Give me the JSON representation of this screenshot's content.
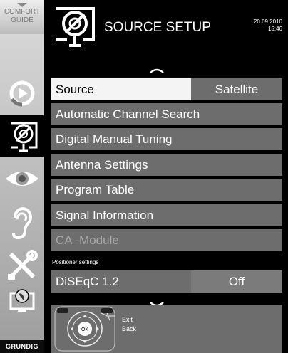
{
  "sidebar": {
    "comfort_guide": [
      "COMFORT",
      "GUIDE"
    ],
    "icons": [
      "source-icon",
      "satellite-dish-icon",
      "eye-icon",
      "ear-icon",
      "tools-icon",
      "globe-monitor-icon"
    ],
    "active_index": 1,
    "brand": "GRUNDIG"
  },
  "header": {
    "title": "SOURCE SETUP",
    "date": "20.09.2010",
    "time": "15:46",
    "icon": "satellite-dish-icon"
  },
  "menu": {
    "items": [
      {
        "label": "Source",
        "value": "Satellite",
        "selected": true
      },
      {
        "label": "Automatic Channel Search"
      },
      {
        "label": "Digital Manual Tuning"
      },
      {
        "label": "Antenna Settings"
      },
      {
        "label": "Program Table"
      },
      {
        "label": "Signal Information"
      },
      {
        "label": "CA -Module",
        "disabled": true
      }
    ],
    "section_label": "Positioner settings",
    "positioner": {
      "label": "DiSEqC 1.2",
      "value": "Off"
    }
  },
  "remote": {
    "ok_label": "OK",
    "exit_label": "Exit",
    "back_label": "Back"
  },
  "colors": {
    "background": "#000000",
    "row": "#6d6d6d",
    "row_selected": "#f4f4f4",
    "disabled_text": "#a9a9a9"
  }
}
